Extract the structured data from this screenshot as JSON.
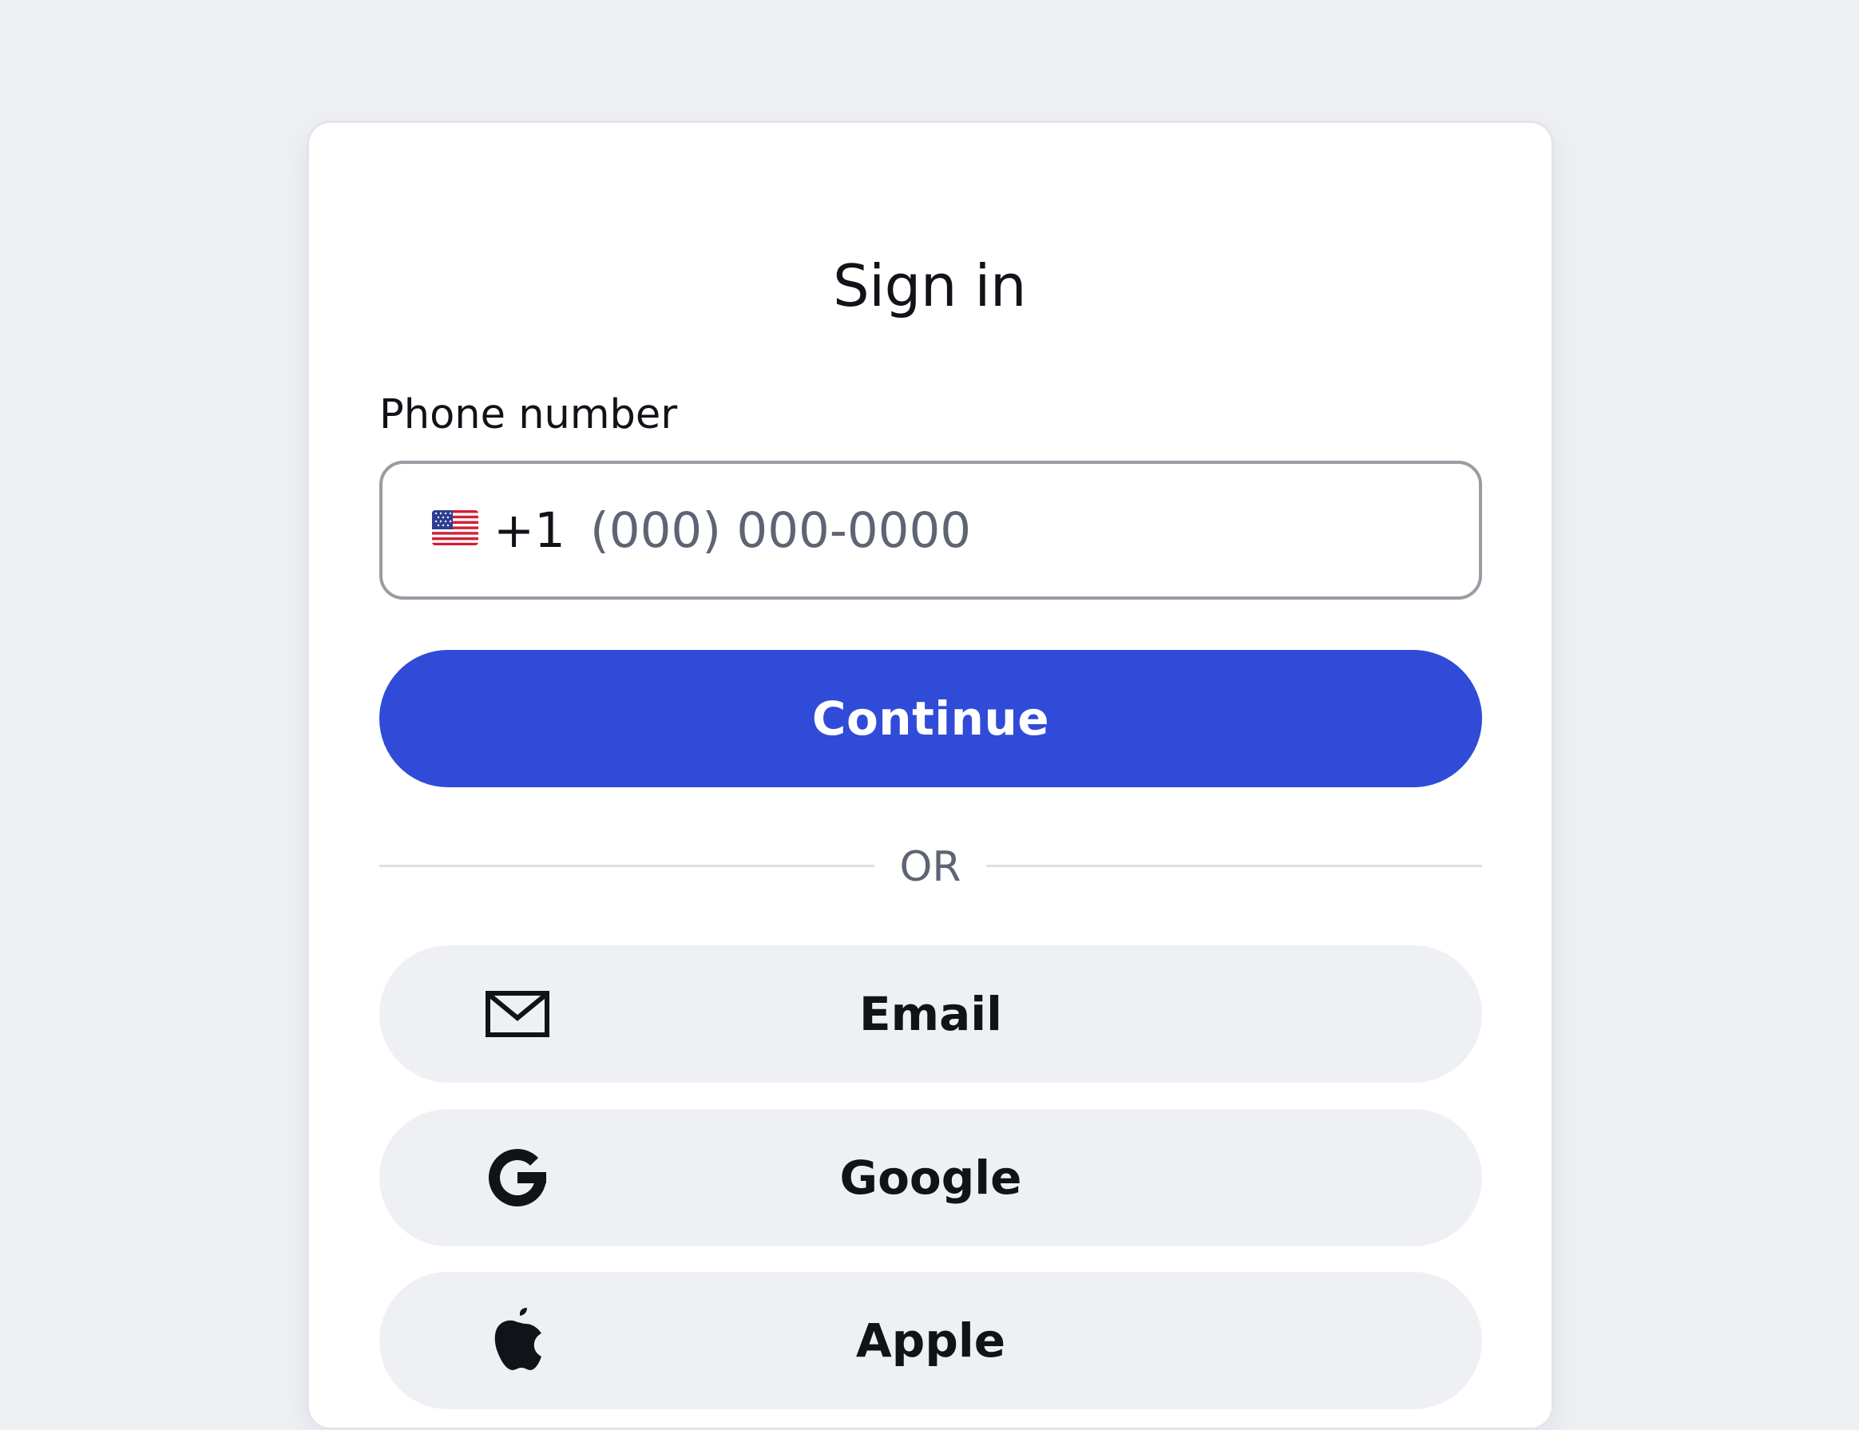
{
  "page": {
    "title": "Sign in"
  },
  "phone": {
    "label": "Phone number",
    "country_icon": "us-flag-icon",
    "country_code": "+1",
    "value": "",
    "placeholder": "(000) 000-0000"
  },
  "actions": {
    "continue_label": "Continue",
    "divider_text": "OR"
  },
  "social": {
    "email": {
      "label": "Email",
      "icon": "mail-icon"
    },
    "google": {
      "label": "Google",
      "icon": "google-icon"
    },
    "apple": {
      "label": "Apple",
      "icon": "apple-icon"
    }
  },
  "colors": {
    "page_background": "#eef0f4",
    "card_background": "#ffffff",
    "primary": "#304bd8",
    "text": "#111318",
    "muted_text": "#5f6474",
    "button_surface": "#eef0f4"
  }
}
